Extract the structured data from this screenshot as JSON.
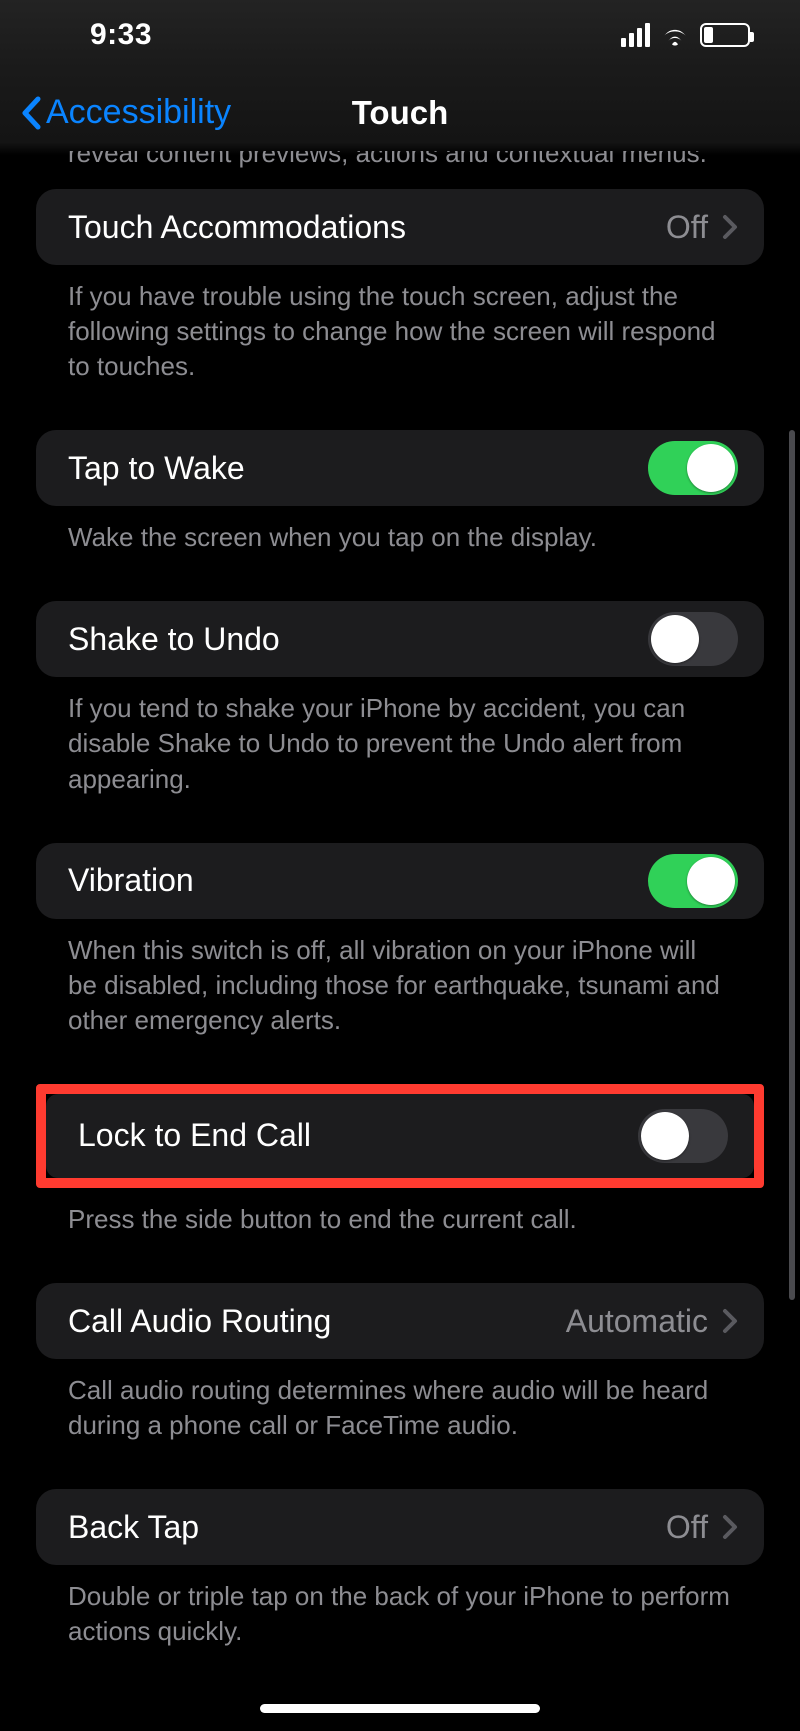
{
  "status": {
    "time": "9:33"
  },
  "nav": {
    "back": "Accessibility",
    "title": "Touch"
  },
  "partial_footer": "reveal content previews, actions and contextual menus.",
  "groups": {
    "touch_acc": {
      "label": "Touch Accommodations",
      "value": "Off",
      "footer": "If you have trouble using the touch screen, adjust the following settings to change how the screen will respond to touches."
    },
    "tap_wake": {
      "label": "Tap to Wake",
      "on": true,
      "footer": "Wake the screen when you tap on the display."
    },
    "shake_undo": {
      "label": "Shake to Undo",
      "on": false,
      "footer": "If you tend to shake your iPhone by accident, you can disable Shake to Undo to prevent the Undo alert from appearing."
    },
    "vibration": {
      "label": "Vibration",
      "on": true,
      "footer": "When this switch is off, all vibration on your iPhone will be disabled, including those for earthquake, tsunami and other emergency alerts."
    },
    "lock_end_call": {
      "label": "Lock to End Call",
      "on": false,
      "footer": "Press the side button to end the current call."
    },
    "call_audio": {
      "label": "Call Audio Routing",
      "value": "Automatic",
      "footer": "Call audio routing determines where audio will be heard during a phone call or FaceTime audio."
    },
    "back_tap": {
      "label": "Back Tap",
      "value": "Off",
      "footer": "Double or triple tap on the back of your iPhone to perform actions quickly."
    }
  }
}
